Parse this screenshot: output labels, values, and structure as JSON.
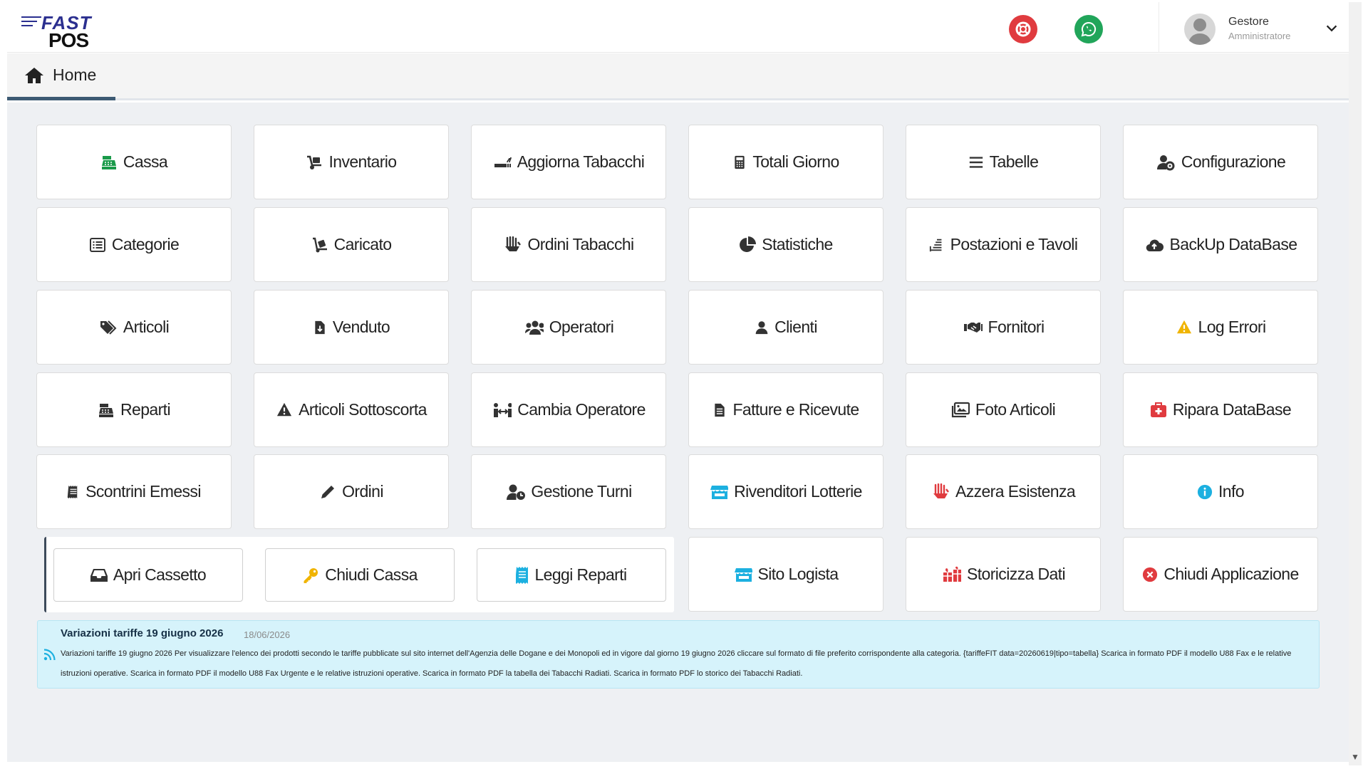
{
  "header": {
    "logo_top": "FAST",
    "logo_bottom": "POS",
    "help_icon": "lifebuoy-icon",
    "whatsapp_icon": "whatsapp-icon",
    "user": {
      "name": "Gestore",
      "role": "Amministratore"
    }
  },
  "tabs": [
    {
      "label": "Home",
      "icon": "home-icon"
    }
  ],
  "tiles": [
    {
      "label": "Cassa",
      "icon": "cash-register-icon",
      "color": "#1a9a4a"
    },
    {
      "label": "Inventario",
      "icon": "dolly-icon",
      "color": "#333333"
    },
    {
      "label": "Aggiorna Tabacchi",
      "icon": "smoking-icon",
      "color": "#333333"
    },
    {
      "label": "Totali Giorno",
      "icon": "calculator-icon",
      "color": "#333333"
    },
    {
      "label": "Tabelle",
      "icon": "bars-icon",
      "color": "#333333"
    },
    {
      "label": "Configurazione",
      "icon": "user-cog-icon",
      "color": "#333333"
    },
    {
      "label": "Categorie",
      "icon": "list-alt-icon",
      "color": "#333333"
    },
    {
      "label": "Caricato",
      "icon": "dolly-flatbed-icon",
      "color": "#333333"
    },
    {
      "label": "Ordini Tabacchi",
      "icon": "hand-holding-icon",
      "color": "#333333"
    },
    {
      "label": "Statistiche",
      "icon": "chart-pie-icon",
      "color": "#333333"
    },
    {
      "label": "Postazioni e Tavoli",
      "icon": "stack-icon",
      "color": "#333333"
    },
    {
      "label": "BackUp DataBase",
      "icon": "cloud-upload-icon",
      "color": "#333333"
    },
    {
      "label": "Articoli",
      "icon": "tags-icon",
      "color": "#333333"
    },
    {
      "label": "Venduto",
      "icon": "file-download-icon",
      "color": "#333333"
    },
    {
      "label": "Operatori",
      "icon": "users-icon",
      "color": "#333333"
    },
    {
      "label": "Clienti",
      "icon": "user-icon",
      "color": "#333333"
    },
    {
      "label": "Fornitori",
      "icon": "handshake-icon",
      "color": "#333333"
    },
    {
      "label": "Log Errori",
      "icon": "warning-icon",
      "color": "#f0b400"
    },
    {
      "label": "Reparti",
      "icon": "cash-register-icon",
      "color": "#333333"
    },
    {
      "label": "Articoli Sottoscorta",
      "icon": "warning-icon",
      "color": "#333333"
    },
    {
      "label": "Cambia Operatore",
      "icon": "people-arrows-icon",
      "color": "#333333"
    },
    {
      "label": "Fatture e Ricevute",
      "icon": "file-invoice-icon",
      "color": "#333333"
    },
    {
      "label": "Foto Articoli",
      "icon": "images-icon",
      "color": "#333333"
    },
    {
      "label": "Ripara DataBase",
      "icon": "first-aid-icon",
      "color": "#e03b3f"
    },
    {
      "label": "Scontrini Emessi",
      "icon": "receipt-icon",
      "color": "#333333"
    },
    {
      "label": "Ordini",
      "icon": "pencil-icon",
      "color": "#333333"
    },
    {
      "label": "Gestione Turni",
      "icon": "user-clock-icon",
      "color": "#333333"
    },
    {
      "label": "Rivenditori Lotterie",
      "icon": "store-icon",
      "color": "#1cb0e0"
    },
    {
      "label": "Azzera Esistenza",
      "icon": "hand-holding-icon",
      "color": "#e03b3f"
    },
    {
      "label": "Info",
      "icon": "info-circle-icon",
      "color": "#1cb0e0"
    },
    {
      "label": "Sito Logista",
      "icon": "store-icon",
      "color": "#1cb0e0"
    },
    {
      "label": "Storicizza Dati",
      "icon": "gifts-icon",
      "color": "#e03b3f"
    },
    {
      "label": "Chiudi Applicazione",
      "icon": "times-circle-icon",
      "color": "#e03b3f"
    }
  ],
  "sub_buttons": [
    {
      "label": "Apri Cassetto",
      "icon": "inbox-icon",
      "color": "#333333"
    },
    {
      "label": "Chiudi Cassa",
      "icon": "key-icon",
      "color": "#f0b400"
    },
    {
      "label": "Leggi Reparti",
      "icon": "receipt-icon",
      "color": "#1cb0e0"
    }
  ],
  "news": {
    "title": "Variazioni tariffe 19 giugno 2026",
    "date": "18/06/2026",
    "icon": "rss-icon",
    "body": "Variazioni tariffe 19 giugno 2026 Per visualizzare l'elenco dei prodotti secondo le tariffe pubblicate sul sito internet dell'Agenzia delle Dogane e dei Monopoli ed in vigore dal giorno 19 giugno 2026 cliccare sul formato di file preferito corrispondente alla categoria. {tariffeFIT data=20260619|tipo=tabella} Scarica in formato PDF il modello U88 Fax e le relative istruzioni operative. Scarica in formato PDF il modello U88 Fax Urgente e le relative istruzioni operative. Scarica in formato PDF la tabella dei Tabacchi Radiati. Scarica in formato PDF lo storico dei Tabacchi Radiati."
  }
}
